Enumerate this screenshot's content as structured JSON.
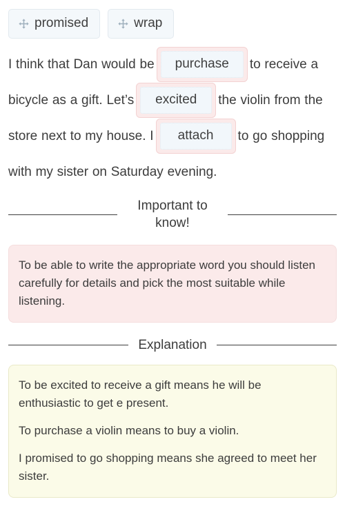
{
  "word_bank": {
    "chips": [
      {
        "label": "promised",
        "icon": "move-arrows-icon"
      },
      {
        "label": "wrap",
        "icon": "move-arrows-icon"
      }
    ]
  },
  "sentence": {
    "segments": [
      {
        "type": "text",
        "text": "I think that Dan would be "
      },
      {
        "type": "blank",
        "answer": "purchase"
      },
      {
        "type": "text",
        "text": " to receive a bicycle as a gift. Let’s "
      },
      {
        "type": "blank",
        "answer": "excited"
      },
      {
        "type": "text",
        "text": " the violin from the store next to my house. I "
      },
      {
        "type": "blank",
        "answer": "attach"
      },
      {
        "type": "text",
        "text": " to go shopping with my sister on Saturday evening."
      }
    ],
    "text_1": "I think that Dan would be",
    "answer_1": "purchase",
    "text_2": "to receive a bicycle as a gift. Let’s",
    "answer_2": "excited",
    "text_3": "the violin from the store next to my house. I",
    "answer_3": "attach",
    "text_4": "to go shopping with my sister on Saturday evening."
  },
  "important_section": {
    "divider_label": "Important to know!",
    "body": "To be able to write the appropriate word you should listen carefully for details and pick the most suitable while listening."
  },
  "explanation_section": {
    "divider_label": "Explanation",
    "paragraphs": [
      "To be excited to receive a gift means he will be enthusiastic to get e present.",
      "To purchase a violin means to buy a violin.",
      "I promised to go shopping means she agreed to meet her sister."
    ],
    "paragraph_1": "To be excited to receive a gift means he will be enthusiastic to get e present.",
    "paragraph_2": "To purchase a violin means to buy a violin.",
    "paragraph_3": "I promised to go shopping means she agreed to meet her sister."
  },
  "colors": {
    "blank_fill": "#fbeaea",
    "blank_border": "#f3d2d2",
    "answer_fill": "#f2f7fb",
    "answer_border": "#dfe7ee",
    "chip_fill": "#f4f8fb",
    "chip_border": "#e2e9ef",
    "important_box_fill": "#fbeaea",
    "explanation_box_fill": "#fbfbe8",
    "text": "#3c3c3c"
  }
}
